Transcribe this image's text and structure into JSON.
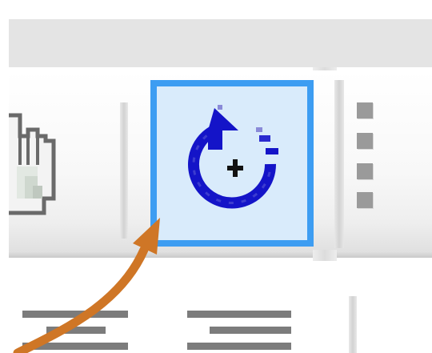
{
  "toolbar": {
    "highlighted_button": {
      "icon": "clone-cycle-icon",
      "accent_color": "#3d9df2",
      "highlight_fill": "#d9ebfb",
      "icon_color": "#1414c8"
    }
  },
  "pointer": {
    "icon": "annotation-arrow-icon",
    "color": "#cf7626"
  }
}
